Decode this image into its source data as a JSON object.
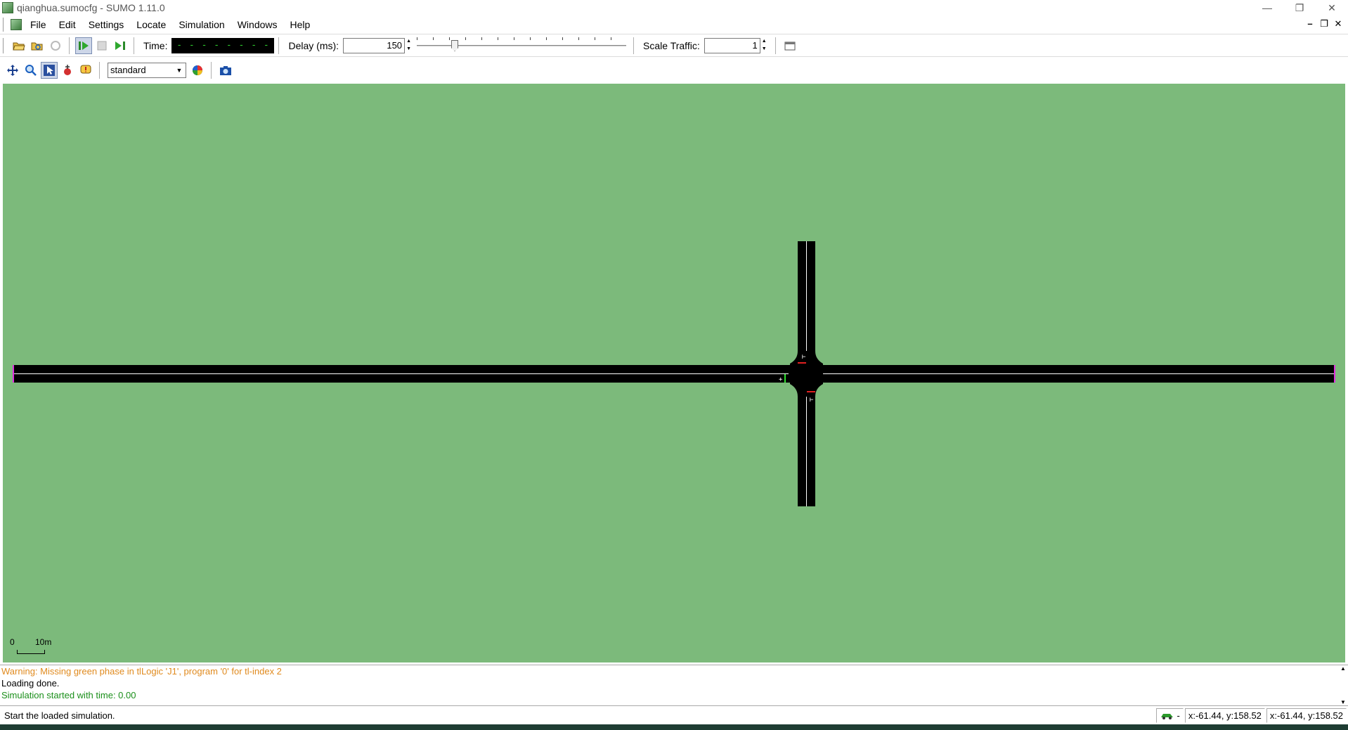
{
  "window": {
    "title": "qianghua.sumocfg - SUMO 1.11.0",
    "controls": {
      "minimize": "—",
      "restore": "❐",
      "close": "✕"
    }
  },
  "menubar": {
    "items": [
      "File",
      "Edit",
      "Settings",
      "Locate",
      "Simulation",
      "Windows",
      "Help"
    ],
    "mdi": {
      "minimize": "–",
      "restore": "❐",
      "close": "✕"
    }
  },
  "toolbar": {
    "time_label": "Time:",
    "time_value": "- - - - - - - - - - - - - - -",
    "delay_label": "Delay (ms):",
    "delay_value": "150",
    "delay_slider_fraction": 0.17,
    "scale_traffic_label": "Scale Traffic:",
    "scale_traffic_value": "1"
  },
  "view_toolbar": {
    "scheme": "standard"
  },
  "canvas": {
    "background": "#7cba7b",
    "scale_bar": {
      "zero": "0",
      "ten": "10m"
    }
  },
  "messages": [
    {
      "type": "warn",
      "text": "Warning: Missing green phase in tlLogic 'J1', program '0' for tl-index 2"
    },
    {
      "type": "info",
      "text": "Loading done."
    },
    {
      "type": "ok",
      "text": "Simulation started with time: 0.00"
    }
  ],
  "statusbar": {
    "text": "Start the loaded simulation.",
    "coords_1": "x:-61.44, y:158.52",
    "coords_2": "x:-61.44, y:158.52"
  }
}
